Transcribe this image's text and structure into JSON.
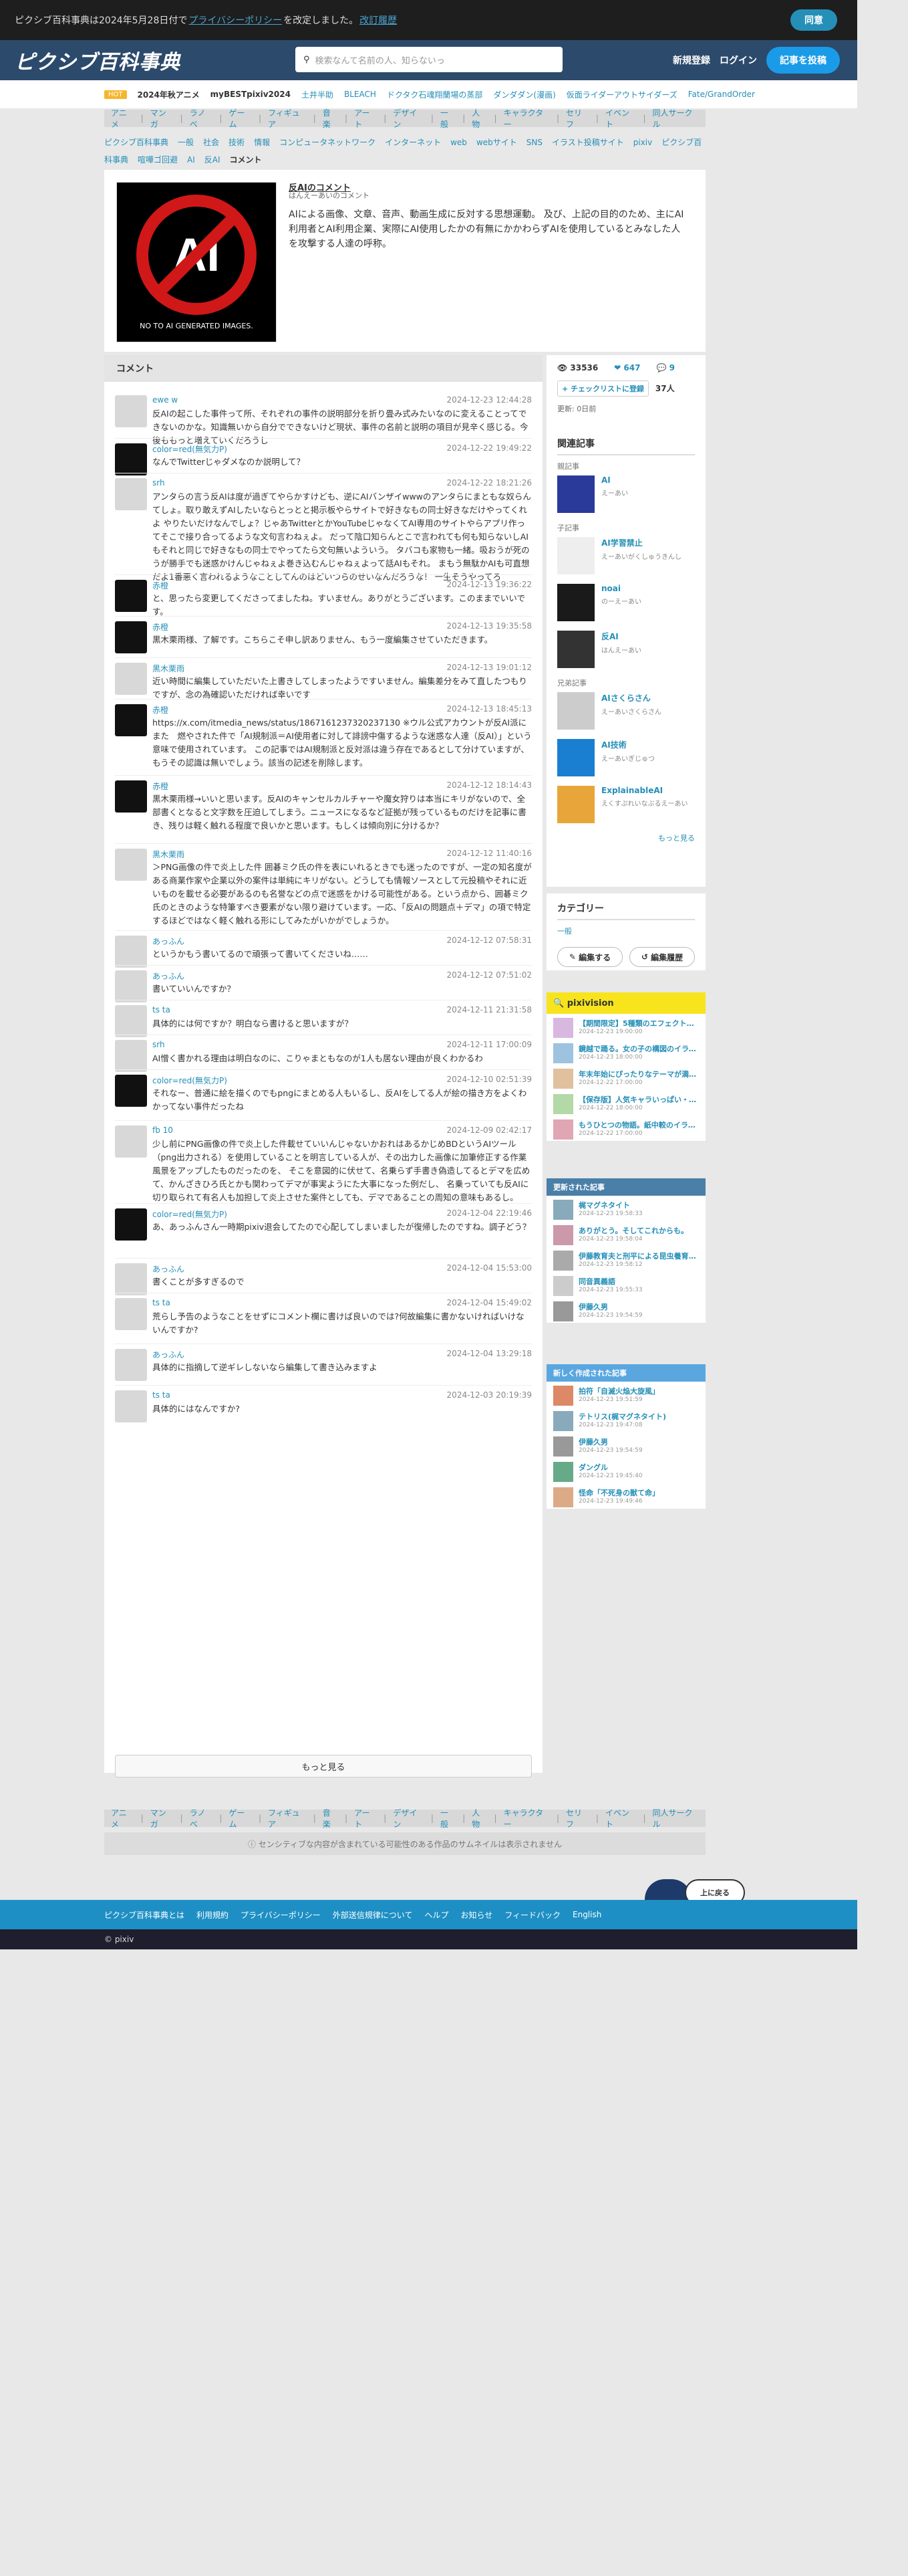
{
  "topbar": {
    "notice_pre": "ピクシブ百科事典は2024年5月28日付で",
    "notice_link": "プライバシーポリシー",
    "notice_post": "を改定しました。",
    "notice_diff": "改訂履歴",
    "agree": "同意"
  },
  "header": {
    "logo": "ピクシブ百科事典",
    "search_placeholder": "検索なんて名前の人、知らないっ",
    "register": "新規登録",
    "login": "ログイン",
    "post": "記事を投稿"
  },
  "strip": {
    "badge": "HOT",
    "items": [
      "2024年秋アニメ",
      "myBESTpixiv2024",
      "土井半助",
      "BLEACH",
      "ドクタク石魂翔蘭場の蒸部",
      "ダンダダン(漫画)",
      "仮面ライダーアウトサイダーズ",
      "Fate/GrandOrder"
    ]
  },
  "categories": [
    "アニメ",
    "マンガ",
    "ラノベ",
    "ゲーム",
    "フィギュア",
    "音楽",
    "アート",
    "デザイン",
    "一般",
    "人物",
    "キャラクター",
    "セリフ",
    "イベント",
    "同人サークル"
  ],
  "breadcrumb": [
    "ピクシブ百科事典",
    "一般",
    "社会",
    "技術",
    "情報",
    "コンピュータネットワーク",
    "インターネット",
    "web",
    "webサイト",
    "SNS",
    "イラスト投稿サイト",
    "pixiv",
    "ピクシブ百科事典",
    "喧嘩ゴ回避",
    "AI",
    "反AI",
    "コメント"
  ],
  "article": {
    "thumb_text": "AI",
    "thumb_caption": "NO TO AI GENERATED IMAGES.",
    "title": "反AIのコメント",
    "reading": "はんえーあいのコメント",
    "description": "AIによる画像、文章、音声、動画生成に反対する思想運動。 及び、上記の目的のため、主にAI利用者とAI利用企業、実際にAI使用したかの有無にかかわらずAIを使用しているとみなした人を攻撃する人達の呼称。"
  },
  "comments_title": "コメント",
  "comments": [
    {
      "name": "ewe w",
      "date": "2024-12-23 12:44:28",
      "text": "反AIの起こした事件って所、それぞれの事件の説明部分を折り畳み式みたいなのに変えることってできないのかな。知識無いから自分でできないけど現状、事件の名前と説明の項目が見辛く感じる。今後ももっと増えていくだろうし"
    },
    {
      "name": "color=red(無気力P)",
      "date": "2024-12-22 19:49:22",
      "text": "なんでTwitterじゃダメなのか説明して？"
    },
    {
      "name": "srh",
      "date": "2024-12-22 18:21:26",
      "text": "アンタらの言う反AIは度が過ぎてやらかすけども、逆にAIバンザイwwwのアンタらにまともな奴らんてしょ。取り敢えずAIしたいならとっとと掲示板やらサイトで好きなもの同士好きなだけやってくれよ やりたいだけなんでしょ？じゃあTwitterとかYouTubeじゃなくてAI専用のサイトやらアプリ作ってそこで接り合ってるような文句言わねぇよ。 だって陰口知らんとこで言われても何も知らないしAIもそれと同じで好きなもの同士でやってたら文句無いよういう。 タバコも家物も一緒。吸おうが死のうが勝手でも迷惑かけんじゃねぇよ巻き込むんじゃねぇよって話AIもそれ。 まもう無駄かAIも可直想だよ1番悪く言われるようなことしてんのはどいつらのせいなんだろうな！ 一生そうやってろ"
    },
    {
      "name": "赤橙",
      "date": "2024-12-13 19:36:22",
      "text": "と、思ったら変更してくださってましたね。すいません。ありがとうございます。このままでいいです。"
    },
    {
      "name": "赤橙",
      "date": "2024-12-13 19:35:58",
      "text": "黒木栗雨様、了解です。こちらこそ申し訳ありません、もう一度編集させていただきます。"
    },
    {
      "name": "黒木栗雨",
      "date": "2024-12-13 19:01:12",
      "text": "近い時間に編集していただいた上書きしてしまったようですいません。編集差分をみて直したつもりですが、念の為確認いただければ幸いです"
    },
    {
      "name": "赤橙",
      "date": "2024-12-13 18:45:13",
      "text": "https://x.com/itmedia_news/status/1867161237320237130 ※ウル公式アカウントが反AI派に　また　燃やされた件で「AI規制派＝AI使用者に対して誹謗中傷するような迷惑な人達（反AI）」という意味で使用されています。 この記事ではAI規制派と反対派は違う存在であるとして分けていますが、もうその認識は無いでしょう。該当の記述を削除します。"
    },
    {
      "name": "赤橙",
      "date": "2024-12-12 18:14:43",
      "text": "黒木栗雨様→いいと思います。反AIのキャンセルカルチャーや魔女狩りは本当にキリがないので、全部書くとなると文字数を圧迫してしまう。ニュースになるなど証拠が残っているものだけを記事に書き、残りは軽く触れる程度で良いかと思います。もしくは傾向別に分けるか？"
    },
    {
      "name": "黒木栗雨",
      "date": "2024-12-12 11:40:16",
      "text": "＞PNG画像の件で炎上した件 囲碁ミク氏の件を表にいれるときでも迷ったのですが、一定の知名度がある商業作家や企業以外の案件は単純にキリがない。どうしても情報ソースとして元投稿やそれに近いものを載せる必要があるのも名誉などの点で迷惑をかける可能性がある。という点から、囲碁ミク氏のときのような特筆すべき要素がない限り避けています。一応、「反AIの問題点＋デマ」の項で特定するほどではなく軽く触れる形にしてみたがいかがでしょうか。"
    },
    {
      "name": "あっふん",
      "date": "2024-12-12 07:58:31",
      "text": "というかもう書いてるので頑張って書いてくださいね……"
    },
    {
      "name": "あっふん",
      "date": "2024-12-12 07:51:02",
      "text": "書いていいんですか？"
    },
    {
      "name": "ts ta",
      "date": "2024-12-11 21:31:58",
      "text": "具体的には何ですか？明白なら書けると思いますが？"
    },
    {
      "name": "srh",
      "date": "2024-12-11 17:00:09",
      "text": "AI憎く書かれる理由は明白なのに、こりゃまともなのが1人も居ない理由が良くわかるわ"
    },
    {
      "name": "color=red(無気力P)",
      "date": "2024-12-10 02:51:39",
      "text": "それなー、普通に絵を描くのでもpngにまとめる人もいるし、反AIをしてる人が絵の描き方をよくわかってない事件だったね"
    },
    {
      "name": "fb 10",
      "date": "2024-12-09 02:42:17",
      "text": "少し前にPNG画像の件で炎上した件載せていいんじゃないかおれはあるかじめBDというAIツール（png出力される）を使用していることを明言している人が、その出力した画像に加筆修正する作業風景をアップしたものだったのを、 そこを意図的に伏せて、名乗らず手書き偽造してるとデマを広めて、かんざきひろ氏とかも関わってデマが事実ようにた大事になった例だし、 名乗っていても反AIに切り取られて有名人も加担して炎上させた案件としても、デマであることの周知の意味もあるし。"
    },
    {
      "name": "color=red(無気力P)",
      "date": "2024-12-04 22:19:46",
      "text": "あ、あっふんさん一時期pixiv退会してたので心配してしまいましたが復帰したのですね。調子どう？"
    },
    {
      "name": "あっふん",
      "date": "2024-12-04 15:53:00",
      "text": "書くことが多すぎるので"
    },
    {
      "name": "ts ta",
      "date": "2024-12-04 15:49:02",
      "text": "荒らし予告のようなことをせずにコメント欄に書けば良いのでは?何故編集に書かないければいけないんですか?"
    },
    {
      "name": "あっふん",
      "date": "2024-12-04 13:29:18",
      "text": "具体的に指摘して逆ギレしないなら編集して書き込みますよ"
    },
    {
      "name": "ts ta",
      "date": "2024-12-03 20:19:39",
      "text": "具体的にはなんですか?"
    }
  ],
  "more_label": "もっと見る",
  "stats": {
    "views": "33536",
    "likes": "647",
    "comments": "9",
    "checklist": "チェックリストに登録",
    "checklist_count": "37人",
    "updated": "更新: 0日前"
  },
  "related": {
    "title": "関連記事",
    "parent_label": "親記事",
    "child_label": "子記事",
    "sibling_label": "兄弟記事",
    "parent": [
      {
        "name": "AI",
        "reading": "えーあい"
      }
    ],
    "children": [
      {
        "name": "AI学習禁止",
        "reading": "えーあいがくしゅうきんし"
      },
      {
        "name": "noai",
        "reading": "のーえーあい"
      },
      {
        "name": "反AI",
        "reading": "はんえーあい"
      }
    ],
    "siblings": [
      {
        "name": "AIさくらさん",
        "reading": "えーあいさくらさん"
      },
      {
        "name": "AI技術",
        "reading": "えーあいぎじゅつ"
      },
      {
        "name": "ExplainableAI",
        "reading": "えくすぷれいなぶるえーあい"
      }
    ],
    "more": "もっと見る"
  },
  "category_box": {
    "title": "カテゴリー",
    "value": "一般",
    "edit": "編集する",
    "history": "編集履歴"
  },
  "pixivision": {
    "title": "pixivision",
    "items": [
      {
        "name": "【期間限定】5種類のエフェクトを…",
        "date": "2024-12-23 19:00:00"
      },
      {
        "name": "鏡越で踊る。女の子の構図のイラス…",
        "date": "2024-12-23 18:00:00"
      },
      {
        "name": "年末年始にぴったりなテーマが満載…",
        "date": "2024-12-22 17:00:00"
      },
      {
        "name": "【保存版】人気キャラいっぱい・プ…",
        "date": "2024-12-22 18:00:00"
      },
      {
        "name": "もうひとつの物語。紙中較のイラス…",
        "date": "2024-12-22 17:00:00"
      }
    ]
  },
  "updated_articles": {
    "title": "更新された記事",
    "items": [
      {
        "name": "梶マグネタイト",
        "date": "2024-12-23 19:58:33"
      },
      {
        "name": "ありがとう。そしてこれからも。",
        "date": "2024-12-23 19:58:04"
      },
      {
        "name": "伊藤教育夫と刑平による昆虫養育のヒルカママン",
        "date": "2024-12-23 19:58:12"
      },
      {
        "name": "同音異義語",
        "date": "2024-12-23 19:55:33"
      },
      {
        "name": "伊藤久男",
        "date": "2024-12-23 19:54:59"
      }
    ]
  },
  "new_articles": {
    "title": "新しく作成された記事",
    "items": [
      {
        "name": "拍符「自滅火焔大旋風」",
        "date": "2024-12-23 19:51:59"
      },
      {
        "name": "テトリス(梶マグネタイト)",
        "date": "2024-12-23 19:47:08"
      },
      {
        "name": "伊藤久男",
        "date": "2024-12-23 19:54:59"
      },
      {
        "name": "ダングル",
        "date": "2024-12-23 19:45:40"
      },
      {
        "name": "怪命「不死身の獣て命」",
        "date": "2024-12-23 19:49:46"
      }
    ]
  },
  "notice": "センシティブな内容が含まれている可能性のある作品のサムネイルは表示されません",
  "footer": {
    "links": [
      "ピクシブ百科事典とは",
      "利用規約",
      "プライバシーポリシー",
      "外部送信規律について",
      "ヘルプ",
      "お知らせ",
      "フィードバック",
      "English"
    ],
    "copyright": "© pixiv",
    "back_to_top": "上に戻る"
  }
}
